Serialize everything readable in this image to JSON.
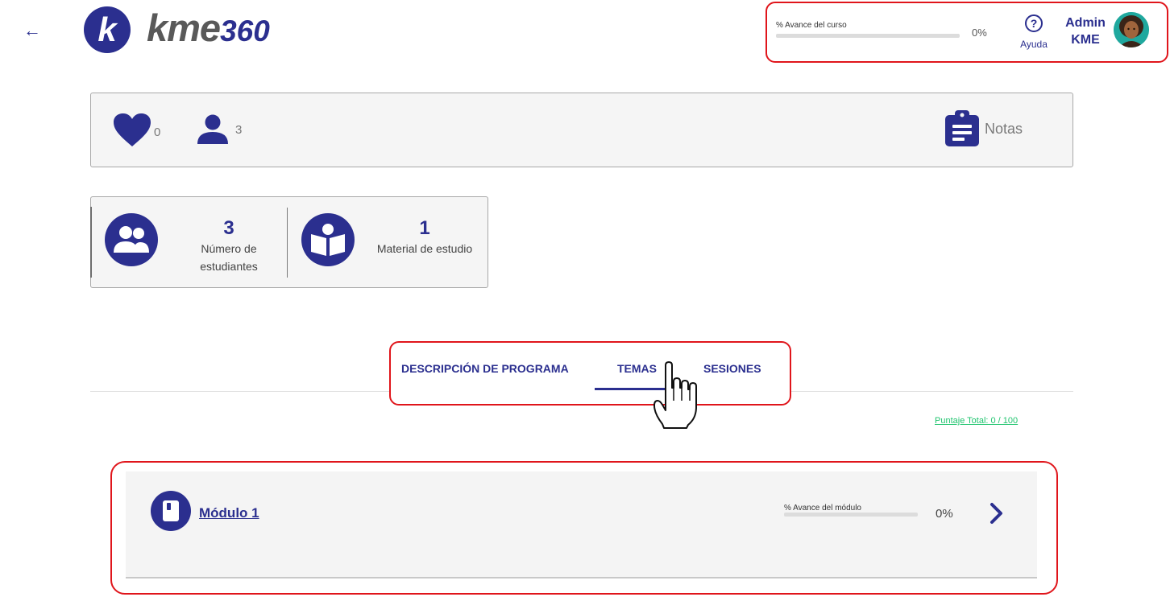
{
  "header": {
    "back_icon": "arrow-left-icon",
    "logo": {
      "mark_letter": "k",
      "brand": "kme",
      "brand_number": "360"
    },
    "course_progress": {
      "label": "% Avance del curso",
      "value": "0%",
      "fraction": 0
    },
    "help": {
      "icon": "question-circle-icon",
      "label": "Ayuda"
    },
    "user": {
      "first_name": "Admin",
      "last_name": "KME",
      "avatar": "user-avatar"
    }
  },
  "stats": {
    "likes": {
      "icon": "heart-icon",
      "count": "0"
    },
    "viewers": {
      "icon": "person-icon",
      "count": "3"
    },
    "notes": {
      "icon": "clipboard-icon",
      "label": "Notas"
    }
  },
  "summary": {
    "students": {
      "icon": "group-icon",
      "value": "3",
      "label_line1": "Número de",
      "label_line2": "estudiantes"
    },
    "material": {
      "icon": "book-reader-icon",
      "value": "1",
      "label": "Material de estudio"
    }
  },
  "tabs": [
    {
      "label": "DESCRIPCIÓN DE PROGRAMA",
      "active": false
    },
    {
      "label": "TEMAS",
      "active": true
    },
    {
      "label": "SESIONES",
      "active": false
    }
  ],
  "total_score": "Puntaje Total: 0 / 100",
  "modules": [
    {
      "icon": "book-icon",
      "title": "Módulo 1",
      "progress_label": "% Avance del módulo",
      "progress_value": "0%",
      "fraction": 0,
      "action_icon": "chevron-right-icon"
    }
  ],
  "colors": {
    "primary": "#2b2f8f",
    "highlight_border": "#e0151b",
    "score_green": "#1fc46e",
    "card_bg": "#f5f5f5"
  }
}
